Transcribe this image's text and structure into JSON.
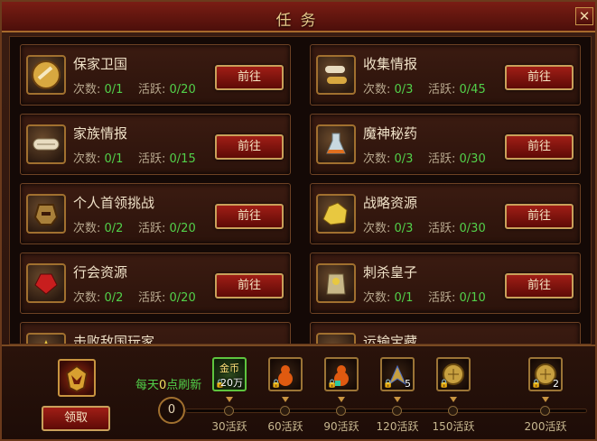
{
  "window": {
    "title": "任务",
    "close_glyph": "✕"
  },
  "tasks": [
    {
      "name": "保家卫国",
      "count_label": "次数:",
      "count": "0/1",
      "active_label": "活跃:",
      "active": "0/20",
      "button": "前往",
      "icon": "medal-icon"
    },
    {
      "name": "收集情报",
      "count_label": "次数:",
      "count": "0/3",
      "active_label": "活跃:",
      "active": "0/45",
      "button": "前往",
      "icon": "scroll-bundle-icon"
    },
    {
      "name": "家族情报",
      "count_label": "次数:",
      "count": "0/1",
      "active_label": "活跃:",
      "active": "0/15",
      "button": "前往",
      "icon": "scroll-icon"
    },
    {
      "name": "魔神秘药",
      "count_label": "次数:",
      "count": "0/3",
      "active_label": "活跃:",
      "active": "0/30",
      "button": "前往",
      "icon": "potion-icon"
    },
    {
      "name": "个人首领挑战",
      "count_label": "次数:",
      "count": "0/2",
      "active_label": "活跃:",
      "active": "0/20",
      "button": "前往",
      "icon": "helmet-icon"
    },
    {
      "name": "战略资源",
      "count_label": "次数:",
      "count": "0/3",
      "active_label": "活跃:",
      "active": "0/30",
      "button": "前往",
      "icon": "gold-ore-icon"
    },
    {
      "name": "行会资源",
      "count_label": "次数:",
      "count": "0/2",
      "active_label": "活跃:",
      "active": "0/20",
      "button": "前往",
      "icon": "red-gem-icon"
    },
    {
      "name": "刺杀皇子",
      "count_label": "次数:",
      "count": "0/1",
      "active_label": "活跃:",
      "active": "0/10",
      "button": "前往",
      "icon": "sack-icon"
    },
    {
      "name": "击败敌国玩家",
      "icon": "star-icon"
    },
    {
      "name": "运输宝藏",
      "icon": "cart-icon"
    }
  ],
  "bottom": {
    "claim_button": "领取",
    "refresh_prefix": "每天",
    "refresh_zero": "0",
    "refresh_suffix": "点刷新",
    "current_progress": "0",
    "progress_fraction": 0,
    "rewards": [
      {
        "caption": "金币",
        "count": "20万",
        "icon": "gold-coin-icon",
        "milestone": "30活跃"
      },
      {
        "caption": "",
        "count": "",
        "icon": "gourd-icon",
        "milestone": "60活跃"
      },
      {
        "caption": "",
        "count": "",
        "icon": "gourd-buff-icon",
        "milestone": "90活跃"
      },
      {
        "caption": "",
        "count": "5",
        "icon": "wings-icon",
        "milestone": "120活跃"
      },
      {
        "caption": "",
        "count": "",
        "icon": "gold-orb-icon",
        "milestone": "150活跃"
      },
      {
        "caption": "",
        "count": "2",
        "icon": "gold-orb-icon",
        "milestone": "200活跃"
      }
    ]
  },
  "colors": {
    "accent_green": "#52d14a",
    "button_red": "#a01e16",
    "frame_gold": "#c9a05a"
  }
}
